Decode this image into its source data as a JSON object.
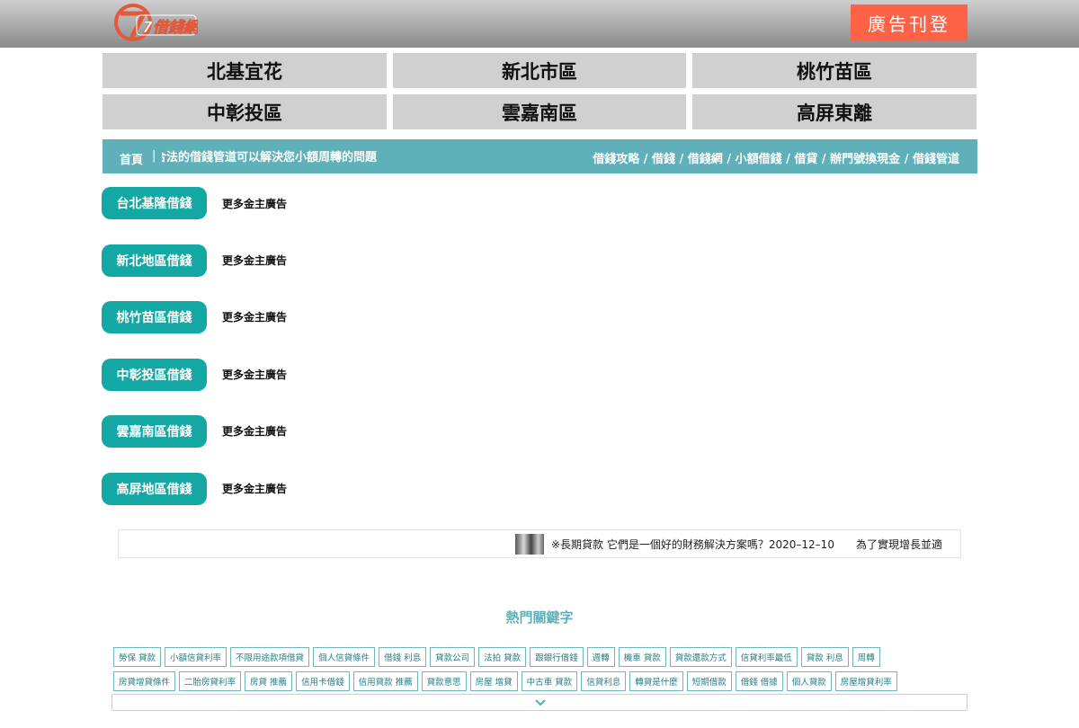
{
  "header": {
    "logo_text": "7借錢網",
    "ad_button": "廣告刊登"
  },
  "regions": [
    "北基宜花",
    "新北市區",
    "桃竹苗區",
    "中彰投區",
    "雲嘉南區",
    "高屏東離"
  ],
  "nav": {
    "home": "首頁",
    "separator": "|",
    "marquee": "合法的借錢管道可以解決您小額周轉的問題",
    "crumbs": "借錢攻略 / 借錢 / 借錢網 / 小額借錢 / 借貸 / 辦門號換現金 / 借錢管道"
  },
  "categories": [
    {
      "label": "台北基隆借錢",
      "more": "更多金主廣告"
    },
    {
      "label": "新北地區借錢",
      "more": "更多金主廣告"
    },
    {
      "label": "桃竹苗區借錢",
      "more": "更多金主廣告"
    },
    {
      "label": "中彰投區借錢",
      "more": "更多金主廣告"
    },
    {
      "label": "雲嘉南區借錢",
      "more": "更多金主廣告"
    },
    {
      "label": "高屏地區借錢",
      "more": "更多金主廣告"
    }
  ],
  "ticker": {
    "text": "※長期貸款 它們是一個好的財務解決方案嗎？2020–12–10　　為了實現增長並適"
  },
  "keywords": {
    "title": "熱門關鍵字",
    "row1": [
      "勞保 貸款",
      "小額信貸利率",
      "不限用途款項借貸",
      "個人信貸條件",
      "借錢 利息",
      "貸款公司",
      "法拍 貸款",
      "跟銀行借錢",
      "週轉",
      "機車 貸款",
      "貸款還款方式",
      "信貸利率最低",
      "貸款 利息",
      "周轉"
    ],
    "row2": [
      "房貸增貸條件",
      "二胎房貸利率",
      "房貸 推薦",
      "信用卡借錢",
      "信用貸款 推薦",
      "貸款意思",
      "房屋 增貸",
      "中古車 貸款",
      "信貸利息",
      "轉貸是什麼",
      "短期借款",
      "借錢 借據",
      "個人貸款",
      "房屋增貸利率"
    ]
  }
}
